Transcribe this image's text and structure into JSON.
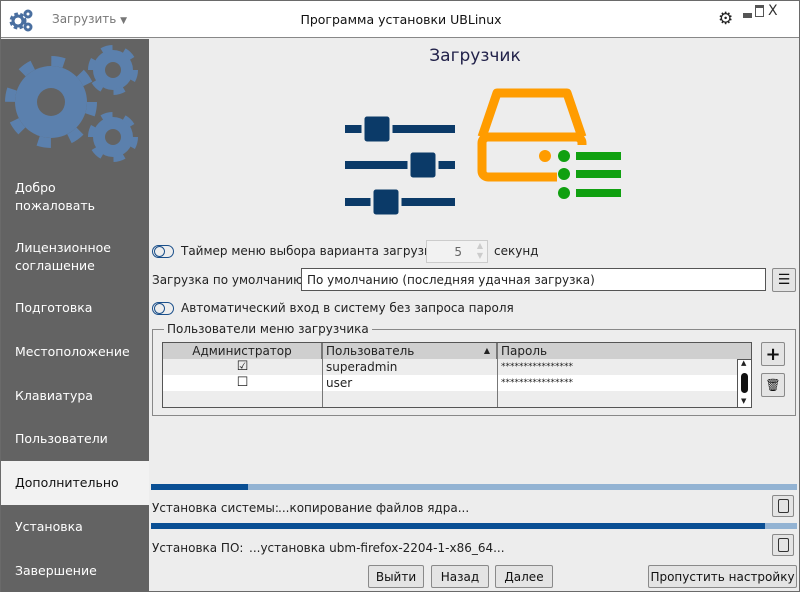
{
  "titlebar": {
    "menu_label": "Загрузить",
    "title": "Программа установки UBLinux"
  },
  "sidebar": {
    "items": [
      {
        "label": "Добро пожаловать"
      },
      {
        "label": "Лицензионное соглашение"
      },
      {
        "label": "Подготовка"
      },
      {
        "label": "Местоположение"
      },
      {
        "label": "Клавиатура"
      },
      {
        "label": "Пользователи"
      },
      {
        "label": "Дополнительно",
        "selected": true
      },
      {
        "label": "Установка"
      },
      {
        "label": "Завершение"
      }
    ]
  },
  "main": {
    "title": "Загрузчик",
    "timer": {
      "label": "Таймер меню выбора варианта загрузки:",
      "value": "5",
      "unit": "секунд",
      "enabled": false
    },
    "default_boot": {
      "label": "Загрузка по умолчанию:",
      "value": "По умолчанию (последняя удачная загрузка)"
    },
    "autologin": {
      "label": "Автоматический вход в систему без запроса пароля",
      "enabled": false
    },
    "users_group": {
      "title": "Пользователи меню загрузчика",
      "columns": [
        "Администратор",
        "Пользователь",
        "Пароль"
      ],
      "rows": [
        {
          "admin": true,
          "admin_mark": "☑",
          "user": "superadmin",
          "password": "****************"
        },
        {
          "admin": false,
          "admin_mark": "☐",
          "user": "user",
          "password": "****************"
        }
      ]
    }
  },
  "progress": {
    "system": {
      "label": "Установка системы:",
      "status": "...копирование файлов ядра...",
      "percent": 15
    },
    "software": {
      "label": "Установка ПО:",
      "status": "...установка ubm-firefox-2204-1-x86_64...",
      "percent": 95
    }
  },
  "buttons": {
    "exit": "Выйти",
    "back": "Назад",
    "next": "Далее",
    "skip": "Пропустить настройку"
  },
  "colors": {
    "accent": "#0a4f94",
    "sidebar": "#636363",
    "gears": "#5b80ad",
    "drive": "#ff9c00",
    "list": "#10a010",
    "sliders": "#0b3a68"
  }
}
